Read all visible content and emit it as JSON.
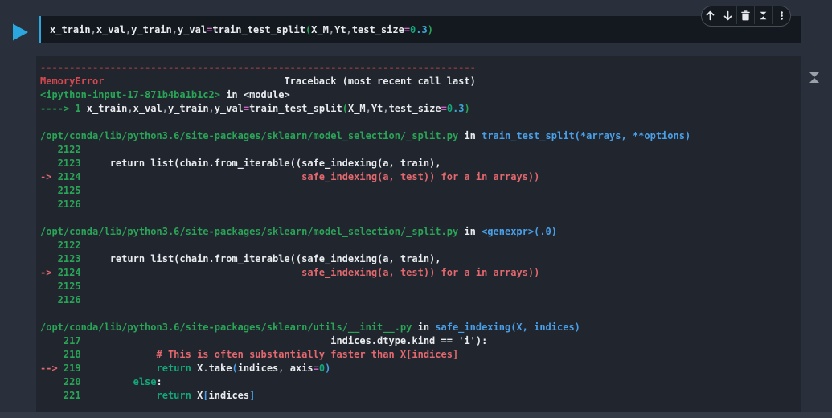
{
  "colors": {
    "white": "#e9ecef",
    "green": "#2aa557",
    "keyword": "#13a87a",
    "blue": "#4aa0e8",
    "red": "#d5494f",
    "salmon": "#e2686e",
    "pink": "#c965c0",
    "cyan": "#3aa8d8",
    "gray": "#99a0a8",
    "accent": "#2ba7e0",
    "icon_gray": "#9aa1a9",
    "page_bg": "#2a303b",
    "cell_bg": "#14181f",
    "output_bg": "#20252e"
  },
  "toolbar": {
    "buttons": [
      {
        "id": "move-cell-up",
        "icon": "arrow-up-icon"
      },
      {
        "id": "move-cell-down",
        "icon": "arrow-down-icon"
      },
      {
        "id": "delete-cell",
        "icon": "trash-icon"
      },
      {
        "id": "collapse-cell",
        "icon": "collapse-icon"
      },
      {
        "id": "more-options",
        "icon": "kebab-menu-icon"
      }
    ]
  },
  "cell": {
    "code": [
      {
        "t": "x_train",
        "c": "white"
      },
      {
        "t": ",",
        "c": "gray"
      },
      {
        "t": "x_val",
        "c": "white"
      },
      {
        "t": ",",
        "c": "gray"
      },
      {
        "t": "y_train",
        "c": "white"
      },
      {
        "t": ",",
        "c": "gray"
      },
      {
        "t": "y_val",
        "c": "white"
      },
      {
        "t": "=",
        "c": "pink"
      },
      {
        "t": "train_test_split",
        "c": "white"
      },
      {
        "t": "(",
        "c": "green"
      },
      {
        "t": "X_M",
        "c": "white"
      },
      {
        "t": ",",
        "c": "gray"
      },
      {
        "t": "Yt",
        "c": "white"
      },
      {
        "t": ",",
        "c": "gray"
      },
      {
        "t": "test_size",
        "c": "white"
      },
      {
        "t": "=",
        "c": "pink"
      },
      {
        "t": "0",
        "c": "keyword"
      },
      {
        "t": ".3",
        "c": "cyan"
      },
      {
        "t": ")",
        "c": "green"
      }
    ]
  },
  "output": {
    "lines": [
      [
        {
          "t": "---------------------------------------------------------------------------",
          "c": "red"
        }
      ],
      [
        {
          "t": "MemoryError",
          "c": "red"
        },
        {
          "t": "                               Traceback (most recent call last)",
          "c": "white"
        }
      ],
      [
        {
          "t": "<ipython-input-17-871b4ba1b1c2>",
          "c": "green"
        },
        {
          "t": " in <module>",
          "c": "white"
        }
      ],
      [
        {
          "t": "----> 1 ",
          "c": "green"
        },
        {
          "t": "x_train",
          "c": "white"
        },
        {
          "t": ",",
          "c": "gray"
        },
        {
          "t": "x_val",
          "c": "white"
        },
        {
          "t": ",",
          "c": "gray"
        },
        {
          "t": "y_train",
          "c": "white"
        },
        {
          "t": ",",
          "c": "gray"
        },
        {
          "t": "y_val",
          "c": "white"
        },
        {
          "t": "=",
          "c": "pink"
        },
        {
          "t": "train_test_split",
          "c": "white"
        },
        {
          "t": "(",
          "c": "green"
        },
        {
          "t": "X_M",
          "c": "white"
        },
        {
          "t": ",",
          "c": "gray"
        },
        {
          "t": "Yt",
          "c": "white"
        },
        {
          "t": ",",
          "c": "gray"
        },
        {
          "t": "test_size",
          "c": "white"
        },
        {
          "t": "=",
          "c": "pink"
        },
        {
          "t": "0",
          "c": "keyword"
        },
        {
          "t": ".3",
          "c": "cyan"
        },
        {
          "t": ")",
          "c": "green"
        }
      ],
      [],
      [
        {
          "t": "/opt/conda/lib/python3.6/site-packages/sklearn/model_selection/_split.py",
          "c": "green"
        },
        {
          "t": " in ",
          "c": "white"
        },
        {
          "t": "train_test_split(*arrays, **options)",
          "c": "blue"
        }
      ],
      [
        {
          "t": "   2122 ",
          "c": "green"
        }
      ],
      [
        {
          "t": "   2123 ",
          "c": "green"
        },
        {
          "t": "    return list(chain.from_iterable((safe_indexing(a, train),",
          "c": "white"
        }
      ],
      [
        {
          "t": "-> ",
          "c": "salmon"
        },
        {
          "t": "2124",
          "c": "green"
        },
        {
          "t": "                                      safe_indexing(a, test)) for a in arrays))",
          "c": "salmon"
        }
      ],
      [
        {
          "t": "   2125 ",
          "c": "green"
        }
      ],
      [
        {
          "t": "   2126 ",
          "c": "green"
        }
      ],
      [],
      [
        {
          "t": "/opt/conda/lib/python3.6/site-packages/sklearn/model_selection/_split.py",
          "c": "green"
        },
        {
          "t": " in ",
          "c": "white"
        },
        {
          "t": "<genexpr>(.0)",
          "c": "blue"
        }
      ],
      [
        {
          "t": "   2122 ",
          "c": "green"
        }
      ],
      [
        {
          "t": "   2123 ",
          "c": "green"
        },
        {
          "t": "    return list(chain.from_iterable((safe_indexing(a, train),",
          "c": "white"
        }
      ],
      [
        {
          "t": "-> ",
          "c": "salmon"
        },
        {
          "t": "2124",
          "c": "green"
        },
        {
          "t": "                                      safe_indexing(a, test)) for a in arrays))",
          "c": "salmon"
        }
      ],
      [
        {
          "t": "   2125 ",
          "c": "green"
        }
      ],
      [
        {
          "t": "   2126 ",
          "c": "green"
        }
      ],
      [],
      [
        {
          "t": "/opt/conda/lib/python3.6/site-packages/sklearn/utils/__init__.py",
          "c": "green"
        },
        {
          "t": " in ",
          "c": "white"
        },
        {
          "t": "safe_indexing(X, indices)",
          "c": "blue"
        }
      ],
      [
        {
          "t": "    217 ",
          "c": "green"
        },
        {
          "t": "                                          indices.dtype.kind == 'i'):",
          "c": "white"
        }
      ],
      [
        {
          "t": "    218 ",
          "c": "green"
        },
        {
          "t": "            # This is often substantially faster than X[indices]",
          "c": "salmon"
        }
      ],
      [
        {
          "t": "--> ",
          "c": "salmon"
        },
        {
          "t": "219",
          "c": "green"
        },
        {
          "t": "             ",
          "c": "white"
        },
        {
          "t": "return",
          "c": "keyword"
        },
        {
          "t": " X",
          "c": "white"
        },
        {
          "t": ".",
          "c": "gray"
        },
        {
          "t": "take",
          "c": "white"
        },
        {
          "t": "(",
          "c": "blue"
        },
        {
          "t": "indices",
          "c": "white"
        },
        {
          "t": ",",
          "c": "gray"
        },
        {
          "t": " axis",
          "c": "white"
        },
        {
          "t": "=",
          "c": "pink"
        },
        {
          "t": "0",
          "c": "keyword"
        },
        {
          "t": ")",
          "c": "blue"
        }
      ],
      [
        {
          "t": "    220 ",
          "c": "green"
        },
        {
          "t": "        ",
          "c": "white"
        },
        {
          "t": "else",
          "c": "keyword"
        },
        {
          "t": ":",
          "c": "white"
        }
      ],
      [
        {
          "t": "    221 ",
          "c": "green"
        },
        {
          "t": "            ",
          "c": "white"
        },
        {
          "t": "return",
          "c": "keyword"
        },
        {
          "t": " X",
          "c": "white"
        },
        {
          "t": "[",
          "c": "blue"
        },
        {
          "t": "indices",
          "c": "white"
        },
        {
          "t": "]",
          "c": "blue"
        }
      ]
    ]
  }
}
